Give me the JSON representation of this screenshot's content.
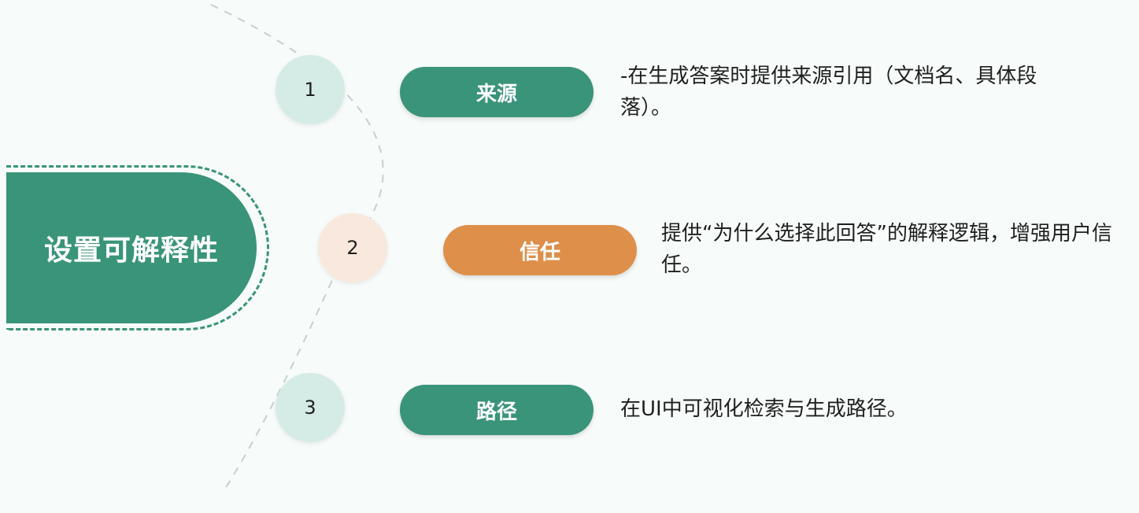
{
  "title": "设置可解释性",
  "colors": {
    "green": "#3a9479",
    "orange": "#de8f4a",
    "circle_green": "#d4ece5",
    "circle_orange": "#f9e8dd"
  },
  "items": [
    {
      "number": "1",
      "label": "来源",
      "description": "-在生成答案时提供来源引用（文档名、具体段落）。"
    },
    {
      "number": "2",
      "label": "信任",
      "description": "提供“为什么选择此回答”的解释逻辑，增强用户信任。"
    },
    {
      "number": "3",
      "label": "路径",
      "description": "在UI中可视化检索与生成路径。"
    }
  ]
}
